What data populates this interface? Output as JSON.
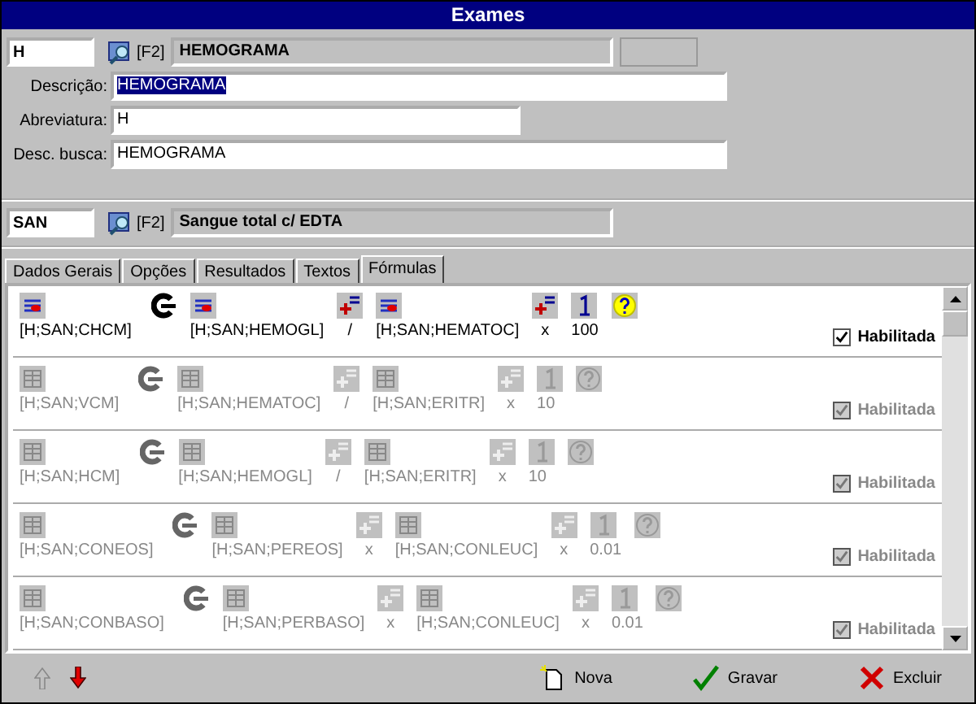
{
  "window": {
    "title": "Exames"
  },
  "exam": {
    "code": "H",
    "lookup_key": "[F2]",
    "name": "HEMOGRAMA"
  },
  "fields": [
    {
      "label": "Descrição:",
      "value": "HEMOGRAMA",
      "selected": true
    },
    {
      "label": "Abreviatura:",
      "value": "H",
      "selected": false
    },
    {
      "label": "Desc. busca:",
      "value": "HEMOGRAMA",
      "selected": false
    }
  ],
  "material": {
    "code": "SAN",
    "lookup_key": "[F2]",
    "name": "Sangue total c/ EDTA"
  },
  "tabs": [
    {
      "label": "Dados Gerais",
      "selected": false
    },
    {
      "label": "Opções",
      "selected": false
    },
    {
      "label": "Resultados",
      "selected": false
    },
    {
      "label": "Textos",
      "selected": false
    },
    {
      "label": "Fórmulas",
      "selected": true
    }
  ],
  "formulas": [
    {
      "active": true,
      "result": "[H;SAN;CHCM]",
      "operand_1": "[H;SAN;HEMOGL]",
      "operator_1": "/",
      "operand_2": "[H;SAN;HEMATOC]",
      "operator_2": "x",
      "constant": "100",
      "enabled_label": "Habilitada",
      "checked": true
    },
    {
      "active": false,
      "result": "[H;SAN;VCM]",
      "operand_1": "[H;SAN;HEMATOC]",
      "operator_1": "/",
      "operand_2": "[H;SAN;ERITR]",
      "operator_2": "x",
      "constant": "10",
      "enabled_label": "Habilitada",
      "checked": true
    },
    {
      "active": false,
      "result": "[H;SAN;HCM]",
      "operand_1": "[H;SAN;HEMOGL]",
      "operator_1": "/",
      "operand_2": "[H;SAN;ERITR]",
      "operator_2": "x",
      "constant": "10",
      "enabled_label": "Habilitada",
      "checked": true
    },
    {
      "active": false,
      "result": "[H;SAN;CONEOS]",
      "operand_1": "[H;SAN;PEREOS]",
      "operator_1": "x",
      "operand_2": "[H;SAN;CONLEUC]",
      "operator_2": "x",
      "constant": "0.01",
      "enabled_label": "Habilitada",
      "checked": true
    },
    {
      "active": false,
      "result": "[H;SAN;CONBASO]",
      "operand_1": "[H;SAN;PERBASO]",
      "operator_1": "x",
      "operand_2": "[H;SAN;CONLEUC]",
      "operator_2": "x",
      "constant": "0.01",
      "enabled_label": "Habilitada",
      "checked": true
    }
  ],
  "nav_arrows": [
    {
      "kind": "up",
      "disabled": true
    },
    {
      "kind": "down",
      "disabled": false
    }
  ],
  "buttons": [
    {
      "kind": "new",
      "label": "Nova"
    },
    {
      "kind": "save",
      "label": "Gravar"
    },
    {
      "kind": "delete",
      "label": "Excluir"
    }
  ]
}
